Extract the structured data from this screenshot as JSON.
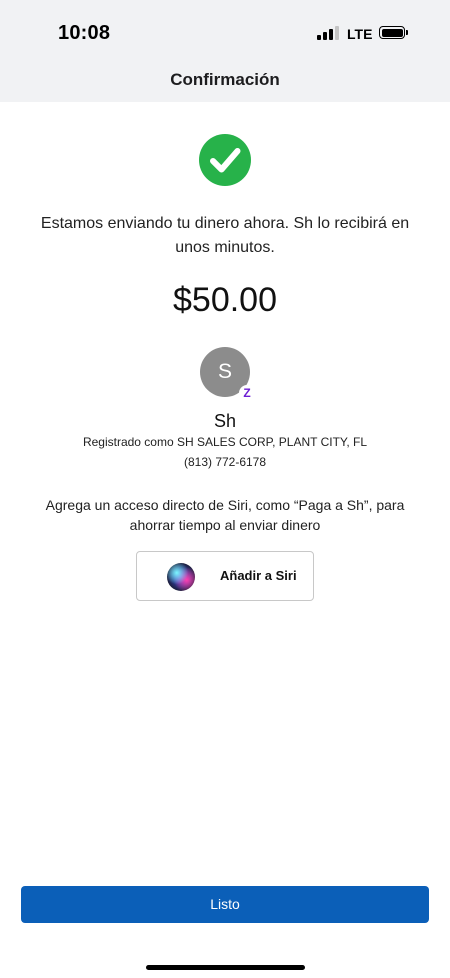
{
  "status_bar": {
    "time": "10:08",
    "network": "LTE",
    "signal_bars_active": 3,
    "battery_level_percent": 100
  },
  "header": {
    "title": "Confirmación"
  },
  "confirmation": {
    "status_icon": "check-circle-icon",
    "status_color": "#27b24a",
    "message": "Estamos enviando tu dinero ahora. Sh lo recibirá en unos minutos.",
    "amount": "$50.00"
  },
  "recipient": {
    "avatar_initial": "S",
    "badge_icon": "zelle-icon",
    "badge_glyph": "Z",
    "badge_color": "#6d1ed4",
    "name": "Sh",
    "registered_as": "Registrado como SH SALES CORP, PLANT CITY, FL",
    "phone": "(813) 772-6178"
  },
  "siri": {
    "prompt": "Agrega un acceso directo de Siri, como “Paga a Sh”, para ahorrar tiempo al enviar dinero",
    "button_icon": "siri-icon",
    "button_label": "Añadir a Siri"
  },
  "footer": {
    "done_label": "Listo",
    "done_color": "#0b5fb8"
  }
}
